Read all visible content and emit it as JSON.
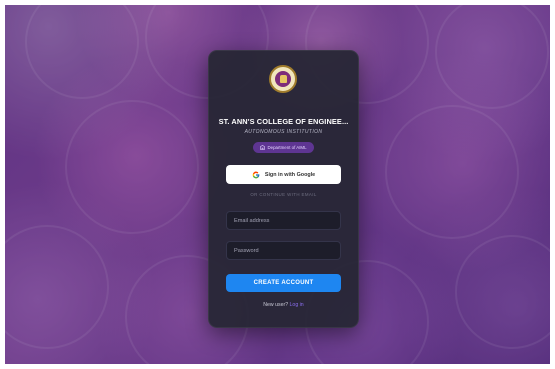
{
  "college": {
    "name": "ST. ANN'S COLLEGE OF ENGINEE...",
    "subtitle": "AUTONOMOUS INSTITUTION",
    "department_badge": "Department of AIML"
  },
  "auth": {
    "google_button_label": "Sign in with Google",
    "divider_text": "OR CONTINUE WITH EMAIL",
    "email_placeholder": "Email address",
    "password_placeholder": "Password",
    "submit_label": "CREATE ACCOUNT",
    "prompt_text": "New user?",
    "prompt_link": "Log in"
  },
  "icons": {
    "logo": "college-seal-icon",
    "badge": "building-icon",
    "google": "google-g-icon"
  },
  "colors": {
    "card": "#262634",
    "primary": "#1e86f1",
    "badge_bg": "#5e3592",
    "link": "#8a6ef0",
    "backdrop": "#6a3a8c"
  }
}
